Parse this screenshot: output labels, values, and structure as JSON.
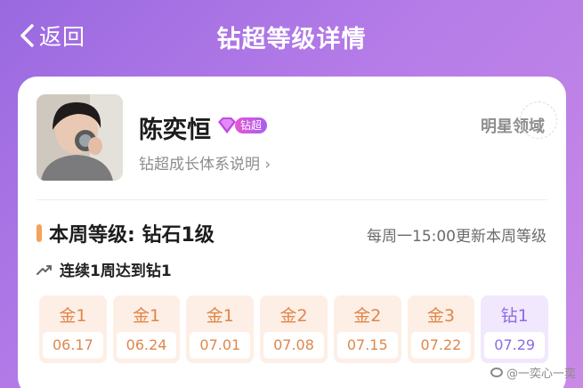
{
  "header": {
    "back_label": "返回",
    "title": "钻超等级详情"
  },
  "profile": {
    "name": "陈奕恒",
    "badge_label": "钻超",
    "system_link": "钻超成长体系说明 ›",
    "star_domain": "明星领域"
  },
  "level": {
    "title": "本周等级: 钻石1级",
    "update_note": "每周一15:00更新本周等级",
    "streak_text": "连续1周达到钻1"
  },
  "weeks": [
    {
      "level": "金1",
      "date": "06.17",
      "tier": "gold"
    },
    {
      "level": "金1",
      "date": "06.24",
      "tier": "gold"
    },
    {
      "level": "金1",
      "date": "07.01",
      "tier": "gold"
    },
    {
      "level": "金2",
      "date": "07.08",
      "tier": "gold"
    },
    {
      "level": "金2",
      "date": "07.15",
      "tier": "gold"
    },
    {
      "level": "金3",
      "date": "07.22",
      "tier": "gold"
    },
    {
      "level": "钻1",
      "date": "07.29",
      "tier": "diamond"
    }
  ],
  "watermark": "@一奕心一奕",
  "colors": {
    "gold_text": "#e0864b",
    "gold_bg": "#fdefe5",
    "diamond_text": "#8d6be4",
    "diamond_bg": "#f1e8fd",
    "level_accent": "#f6a25a"
  }
}
